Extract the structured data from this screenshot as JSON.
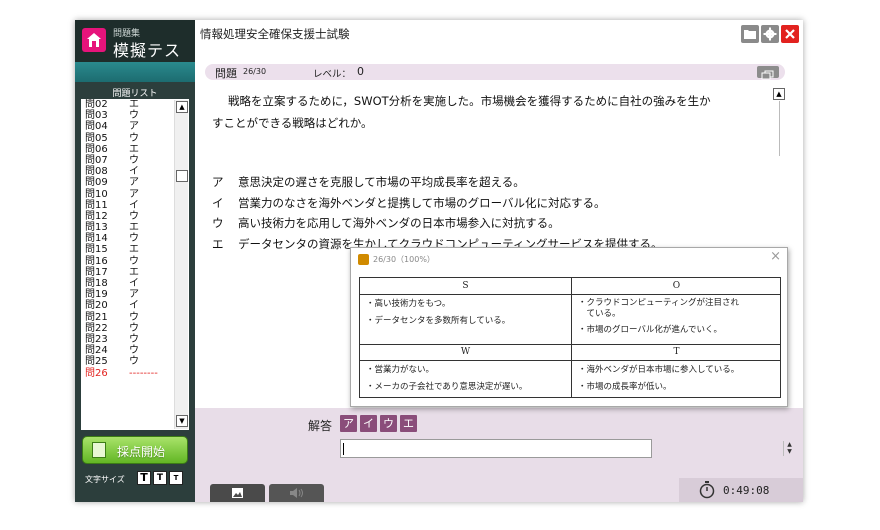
{
  "app": {
    "brand_sub": "問題集",
    "brand_title": "模擬テスト",
    "exam_title": "情報処理安全確保支援士試験"
  },
  "colors": {
    "brand": "#e6147b",
    "accent_purple": "#8a4d7a",
    "sidebar": "#2c3e3c",
    "grade_button": "#62b624",
    "close_button": "#e2221f",
    "current_question": "#e2221f"
  },
  "header": {
    "icons": [
      "folder-icon",
      "gear-icon",
      "close-icon"
    ]
  },
  "sidebar": {
    "list_title": "問題リスト",
    "questions": [
      {
        "label": "問02",
        "answer": "エ"
      },
      {
        "label": "問03",
        "answer": "ウ"
      },
      {
        "label": "問04",
        "answer": "ア"
      },
      {
        "label": "問05",
        "answer": "ウ"
      },
      {
        "label": "問06",
        "answer": "エ"
      },
      {
        "label": "問07",
        "answer": "ウ"
      },
      {
        "label": "問08",
        "answer": "イ"
      },
      {
        "label": "問09",
        "answer": "ア"
      },
      {
        "label": "問10",
        "answer": "ア"
      },
      {
        "label": "問11",
        "answer": "イ"
      },
      {
        "label": "問12",
        "answer": "ウ"
      },
      {
        "label": "問13",
        "answer": "エ"
      },
      {
        "label": "問14",
        "answer": "ウ"
      },
      {
        "label": "問15",
        "answer": "エ"
      },
      {
        "label": "問16",
        "answer": "ウ"
      },
      {
        "label": "問17",
        "answer": "エ"
      },
      {
        "label": "問18",
        "answer": "イ"
      },
      {
        "label": "問19",
        "answer": "ア"
      },
      {
        "label": "問20",
        "answer": "イ"
      },
      {
        "label": "問21",
        "answer": "ウ"
      },
      {
        "label": "問22",
        "answer": "ウ"
      },
      {
        "label": "問23",
        "answer": "ウ"
      },
      {
        "label": "問24",
        "answer": "ウ"
      },
      {
        "label": "問25",
        "answer": "ウ"
      },
      {
        "label": "問26",
        "answer": "--------",
        "current": true
      }
    ],
    "grade_button": "採点開始",
    "font_size_label": "文字サイズ",
    "font_size_buttons": [
      "T",
      "T",
      "T"
    ]
  },
  "question": {
    "label": "問題",
    "counter": "26/30",
    "level_label": "レベル：",
    "level_value": "0",
    "text_line1": "戦略を立案するために，SWOT分析を実施した。市場機会を獲得するために自社の強みを生か",
    "text_line2": "すことができる戦略はどれか。",
    "choices": [
      {
        "key": "ア",
        "text": "意思決定の遅さを克服して市場の平均成長率を超える。"
      },
      {
        "key": "イ",
        "text": "営業力のなさを海外ベンダと提携して市場のグローバル化に対応する。"
      },
      {
        "key": "ウ",
        "text": "高い技術力を応用して海外ベンダの日本市場参入に対抗する。"
      },
      {
        "key": "エ",
        "text": "データセンタの資源を生かしてクラウドコンピューティングサービスを提供する。"
      }
    ]
  },
  "popup": {
    "title": "26/30（100%）",
    "close": "×",
    "swot": {
      "S": {
        "head": "S",
        "items": [
          "・高い技術力をもつ。",
          "・データセンタを多数所有している。"
        ]
      },
      "O": {
        "head": "O",
        "items": [
          "・クラウドコンピューティングが注目され",
          "　ている。",
          "・市場のグローバル化が進んでいく。"
        ]
      },
      "W": {
        "head": "W",
        "items": [
          "・営業力がない。",
          "・メーカの子会社であり意思決定が遅い。"
        ]
      },
      "T": {
        "head": "T",
        "items": [
          "・海外ベンダが日本市場に参入している。",
          "・市場の成長率が低い。"
        ]
      }
    }
  },
  "answer": {
    "label": "解答",
    "options": [
      "ア",
      "イ",
      "ウ",
      "エ"
    ],
    "input_value": ""
  },
  "footer": {
    "timer": "0:49:08",
    "tabs": [
      "image-icon",
      "speaker-icon"
    ]
  }
}
